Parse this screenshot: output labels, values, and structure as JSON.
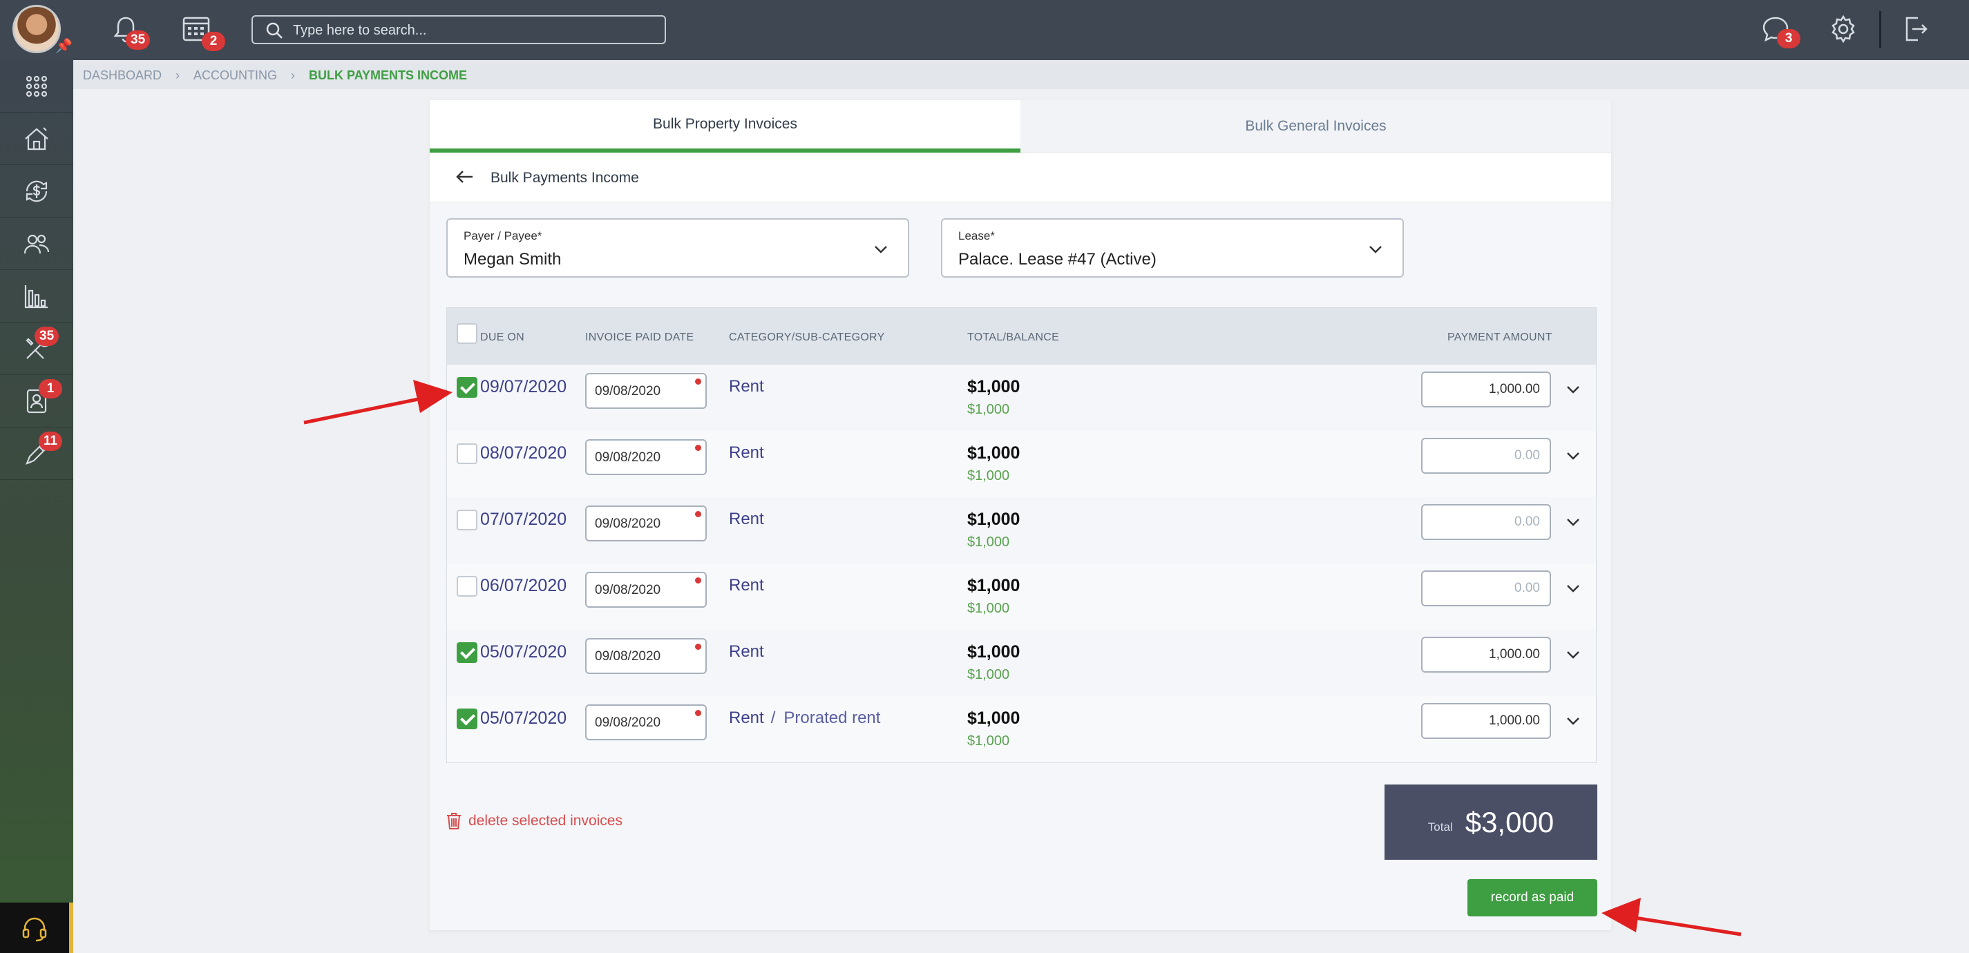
{
  "topbar": {
    "notifications_count": "35",
    "calendar_count": "2",
    "search_placeholder": "Type here to search...",
    "messages_count": "3"
  },
  "sidebar": {
    "items": [
      {
        "icon": "apps-grid-icon",
        "badge": ""
      },
      {
        "icon": "property-house-icon",
        "badge": ""
      },
      {
        "icon": "accounting-dollar-icon",
        "badge": ""
      },
      {
        "icon": "contacts-people-icon",
        "badge": ""
      },
      {
        "icon": "reports-chart-icon",
        "badge": ""
      },
      {
        "icon": "maintenance-tools-icon",
        "badge": "35"
      },
      {
        "icon": "applicants-profile-icon",
        "badge": "1"
      },
      {
        "icon": "tasks-pen-icon",
        "badge": "11"
      }
    ]
  },
  "breadcrumb": {
    "items": [
      "DASHBOARD",
      "ACCOUNTING"
    ],
    "current": "BULK PAYMENTS INCOME"
  },
  "tabs": {
    "property": "Bulk Property Invoices",
    "general": "Bulk General Invoices"
  },
  "page": {
    "title": "Bulk Payments Income"
  },
  "form": {
    "payer_label": "Payer / Payee*",
    "payer_value": "Megan Smith",
    "lease_label": "Lease*",
    "lease_value": "Palace. Lease #47 (Active)"
  },
  "table": {
    "headers": {
      "due_on": "DUE ON",
      "paid_date": "INVOICE PAID DATE",
      "category": "CATEGORY/SUB-CATEGORY",
      "total": "TOTAL/BALANCE",
      "payment": "PAYMENT AMOUNT"
    },
    "rows": [
      {
        "checked": true,
        "due_on": "09/07/2020",
        "paid_date": "09/08/2020",
        "category": "Rent",
        "subcategory": "",
        "total": "$1,000",
        "balance": "$1,000",
        "payment": "1,000.00"
      },
      {
        "checked": false,
        "due_on": "08/07/2020",
        "paid_date": "09/08/2020",
        "category": "Rent",
        "subcategory": "",
        "total": "$1,000",
        "balance": "$1,000",
        "payment": "0.00"
      },
      {
        "checked": false,
        "due_on": "07/07/2020",
        "paid_date": "09/08/2020",
        "category": "Rent",
        "subcategory": "",
        "total": "$1,000",
        "balance": "$1,000",
        "payment": "0.00"
      },
      {
        "checked": false,
        "due_on": "06/07/2020",
        "paid_date": "09/08/2020",
        "category": "Rent",
        "subcategory": "",
        "total": "$1,000",
        "balance": "$1,000",
        "payment": "0.00"
      },
      {
        "checked": true,
        "due_on": "05/07/2020",
        "paid_date": "09/08/2020",
        "category": "Rent",
        "subcategory": "",
        "total": "$1,000",
        "balance": "$1,000",
        "payment": "1,000.00"
      },
      {
        "checked": true,
        "due_on": "05/07/2020",
        "paid_date": "09/08/2020",
        "category": "Rent",
        "subcategory": "Prorated rent",
        "total": "$1,000",
        "balance": "$1,000",
        "payment": "1,000.00"
      }
    ]
  },
  "footer": {
    "delete_label": "delete selected invoices",
    "total_label": "Total",
    "total_value": "$3,000",
    "record_label": "record as paid"
  },
  "colors": {
    "accent_green": "#3e9e42",
    "link_purple": "#3d3f8a",
    "badge_red": "#d93838",
    "annotation_red": "#e02020"
  }
}
